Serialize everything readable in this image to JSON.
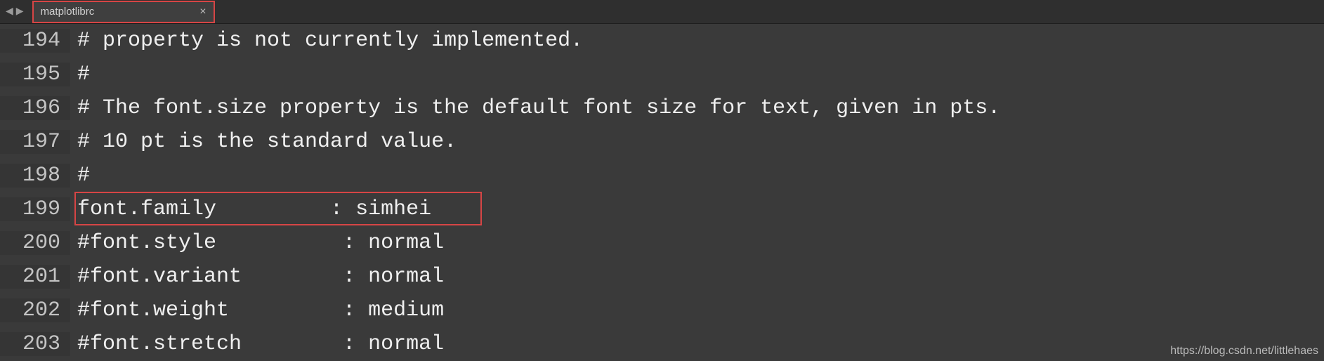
{
  "tab": {
    "title": "matplotlibrc",
    "close_glyph": "×"
  },
  "nav": {
    "prev": "◀",
    "next": "▶"
  },
  "lines": [
    {
      "num": "194",
      "text": "# property is not currently implemented."
    },
    {
      "num": "195",
      "text": "#"
    },
    {
      "num": "196",
      "text": "# The font.size property is the default font size for text, given in pts."
    },
    {
      "num": "197",
      "text": "# 10 pt is the standard value."
    },
    {
      "num": "198",
      "text": "#"
    },
    {
      "num": "199",
      "text": "font.family         : simhei"
    },
    {
      "num": "200",
      "text": "#font.style          : normal"
    },
    {
      "num": "201",
      "text": "#font.variant        : normal"
    },
    {
      "num": "202",
      "text": "#font.weight         : medium"
    },
    {
      "num": "203",
      "text": "#font.stretch        : normal"
    }
  ],
  "watermark": "https://blog.csdn.net/littlehaes"
}
